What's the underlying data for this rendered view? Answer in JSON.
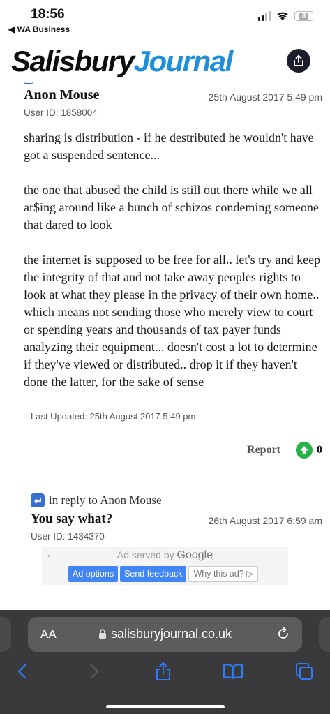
{
  "status": {
    "time": "18:56",
    "back_app": "◀ WA Business",
    "battery": "8"
  },
  "header": {
    "logo_part1": "Salisbury",
    "logo_part2": "Journal",
    "share_icon": "share-icon"
  },
  "comment1": {
    "author": "Anon Mouse",
    "date": "25th August 2017 5:49 pm",
    "user_id": "User ID: 1858004",
    "paragraphs": [
      "sharing is distribution - if he destributed he wouldn't have got a suspended sentence...",
      "the one that abused the child is still out there while we all ar$ing around like a bunch of schizos condeming someone that dared to look",
      "the internet is supposed to be free for all.. let's try and keep the integrity of that and not take away peoples rights to look at what they please in the privacy of their own home.. which means not sending those who merely view to court or spending years and thousands of tax payer funds analyzing their equipment... doesn't cost a lot to determine if they've viewed or distributed.. drop it if they haven't done the latter, for the sake of sense"
    ],
    "last_updated": "Last Updated: 25th August 2017 5:49 pm",
    "report_label": "Report",
    "votes": "0"
  },
  "comment2": {
    "reply_to": "in reply to Anon Mouse",
    "author": "You say what?",
    "date": "26th August 2017 6:59 am",
    "user_id": "User ID: 1434370"
  },
  "ad": {
    "back": "←",
    "served_prefix": "Ad served by",
    "served_brand": "Google",
    "options_label": "Ad options",
    "feedback_label": "Send feedback",
    "why_label": "Why this ad? ▷"
  },
  "browser": {
    "aa_label": "AA",
    "url": "salisburyjournal.co.uk"
  },
  "colors": {
    "brand_blue": "#1f8fd8",
    "vote_green": "#27b24a",
    "toolbar_bg": "#3a3a3c",
    "ios_blue": "#2f7cf6"
  }
}
